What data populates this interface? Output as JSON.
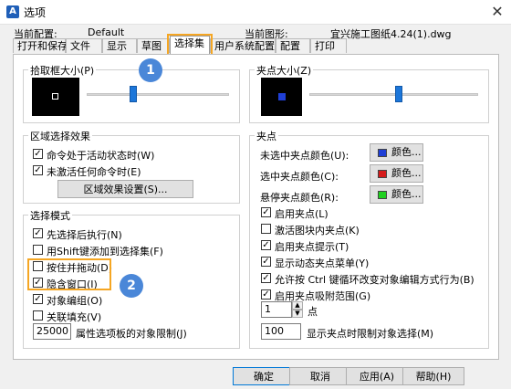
{
  "window": {
    "title": "选项",
    "app_icon": "app-icon",
    "close_glyph": "✕"
  },
  "header": {
    "current_profile_label": "当前配置:",
    "current_profile_value": "Default",
    "current_drawing_label": "当前图形:",
    "current_drawing_value": "宜兴施工图纸4.24(1).dwg"
  },
  "tabs": [
    "打开和保存",
    "文件",
    "显示",
    "草图",
    "选择集",
    "用户系统配置",
    "配置",
    "打印"
  ],
  "active_tab": "选择集",
  "pickbox": {
    "title": "拾取框大小(P)",
    "slider_level": 0.33
  },
  "grip_size": {
    "title": "夹点大小(Z)",
    "slider_level": 0.53
  },
  "area_effect": {
    "title": "区域选择效果",
    "options": [
      {
        "label": "命令处于活动状态时(W)",
        "checked": true
      },
      {
        "label": "未激活任何命令时(E)",
        "checked": true
      }
    ],
    "settings_button": "区域效果设置(S)..."
  },
  "selection_mode": {
    "title": "选择模式",
    "options": [
      {
        "label": "先选择后执行(N)",
        "checked": true
      },
      {
        "label": "用Shift键添加到选择集(F)",
        "checked": false
      },
      {
        "label": "按住并拖动(D)",
        "checked": false
      },
      {
        "label": "隐含窗口(I)",
        "checked": true
      },
      {
        "label": "对象编组(O)",
        "checked": true
      },
      {
        "label": "关联填充(V)",
        "checked": false
      }
    ],
    "limit_value": "25000",
    "limit_label": "属性选项板的对象限制(J)"
  },
  "grips": {
    "title": "夹点",
    "colors": [
      {
        "label": "未选中夹点颜色(U):",
        "button": "颜色...",
        "color": "#1f3fd6"
      },
      {
        "label": "选中夹点颜色(C):",
        "button": "颜色...",
        "color": "#d41a1a"
      },
      {
        "label": "悬停夹点颜色(R):",
        "button": "颜色...",
        "color": "#1fcf1f"
      }
    ],
    "options": [
      {
        "label": "启用夹点(L)",
        "checked": true
      },
      {
        "label": "激活图块内夹点(K)",
        "checked": false
      },
      {
        "label": "启用夹点提示(T)",
        "checked": true
      },
      {
        "label": "显示动态夹点菜单(Y)",
        "checked": true
      },
      {
        "label": "允许按 Ctrl 键循环改变对象编辑方式行为(B)",
        "checked": true
      },
      {
        "label": "启用夹点吸附范围(G)",
        "checked": true
      }
    ],
    "snap_value": "1",
    "snap_unit": "点",
    "limit_value": "100",
    "limit_label": "显示夹点时限制对象选择(M)"
  },
  "annotations": {
    "badge1": "1",
    "badge2": "2"
  },
  "footer": {
    "ok": "确定",
    "cancel": "取消",
    "apply": "应用(A)",
    "help": "帮助(H)"
  }
}
